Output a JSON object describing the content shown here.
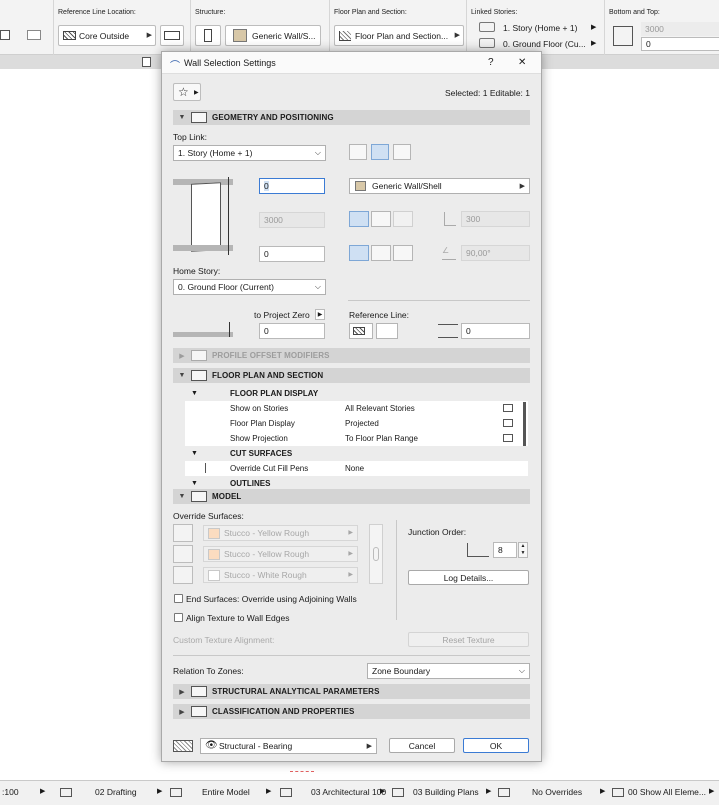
{
  "toolbar": {
    "reference_line_location": {
      "label": "Reference Line Location:",
      "value": "Core Outside"
    },
    "structure": {
      "label": "Structure:",
      "value": "Generic Wall/S..."
    },
    "floor_plan_section": {
      "label": "Floor Plan and Section:",
      "value": "Floor Plan and Section..."
    },
    "linked_stories": {
      "label": "Linked Stories:",
      "top": "1. Story (Home + 1)",
      "bottom": "0. Ground Floor (Cu..."
    },
    "bottom_and_top": {
      "label": "Bottom and Top:",
      "top": "3000",
      "bottom": "0"
    }
  },
  "dialog": {
    "title": "Wall Selection Settings",
    "help": "?",
    "close": "✕",
    "selected_info": "Selected: 1 Editable: 1",
    "geometry": {
      "header": "GEOMETRY AND POSITIONING",
      "top_link_label": "Top Link:",
      "top_link_value": "1. Story (Home + 1)",
      "height_value": "0",
      "height_readonly": "3000",
      "bottom_offset": "0",
      "home_story_label": "Home Story:",
      "home_story_value": "0. Ground Floor (Current)",
      "to_project_zero_label": "to Project Zero",
      "to_project_zero_value": "0",
      "structure_value": "Generic Wall/Shell",
      "thickness": "300",
      "angle": "90,00°",
      "reference_line_label": "Reference Line:",
      "reference_offset": "0"
    },
    "profile_offset": {
      "header": "PROFILE OFFSET MODIFIERS"
    },
    "floor_plan": {
      "header": "FLOOR PLAN AND SECTION",
      "groups": [
        {
          "title": "FLOOR PLAN DISPLAY"
        },
        {
          "title": "CUT SURFACES"
        },
        {
          "title": "OUTLINES"
        }
      ],
      "rows": [
        {
          "name": "Show on Stories",
          "value": "All Relevant Stories"
        },
        {
          "name": "Floor Plan Display",
          "value": "Projected"
        },
        {
          "name": "Show Projection",
          "value": "To Floor Plan Range"
        },
        {
          "name": "Override Cut Fill Pens",
          "value": "None"
        }
      ]
    },
    "model": {
      "header": "MODEL",
      "override_surfaces_label": "Override Surfaces:",
      "surfaces": [
        {
          "name": "Stucco - Yellow Rough",
          "swatch": "#fbdcc0"
        },
        {
          "name": "Stucco - Yellow Rough",
          "swatch": "#fbdcc0"
        },
        {
          "name": "Stucco - White Rough",
          "swatch": "#ffffff"
        }
      ],
      "junction_order_label": "Junction Order:",
      "junction_order_value": "8",
      "log_details": "Log Details...",
      "end_surfaces": "End Surfaces: Override using Adjoining Walls",
      "align_texture": "Align Texture to Wall Edges",
      "custom_texture_alignment": "Custom Texture Alignment:",
      "reset_texture": "Reset Texture"
    },
    "relation_to_zones_label": "Relation To Zones:",
    "relation_to_zones_value": "Zone Boundary",
    "structural_analytical": {
      "header": "STRUCTURAL ANALYTICAL PARAMETERS"
    },
    "classification": {
      "header": "CLASSIFICATION AND PROPERTIES"
    },
    "footer": {
      "layer_value": "Structural - Bearing",
      "cancel": "Cancel",
      "ok": "OK"
    }
  },
  "statusbar": {
    "scale": ":100",
    "drafting": "02 Drafting",
    "entire_model": "Entire Model",
    "architectural": "03 Architectural 100",
    "building_plans": "03 Building Plans",
    "overrides": "No Overrides",
    "show_all": "00 Show All Eleme..."
  }
}
